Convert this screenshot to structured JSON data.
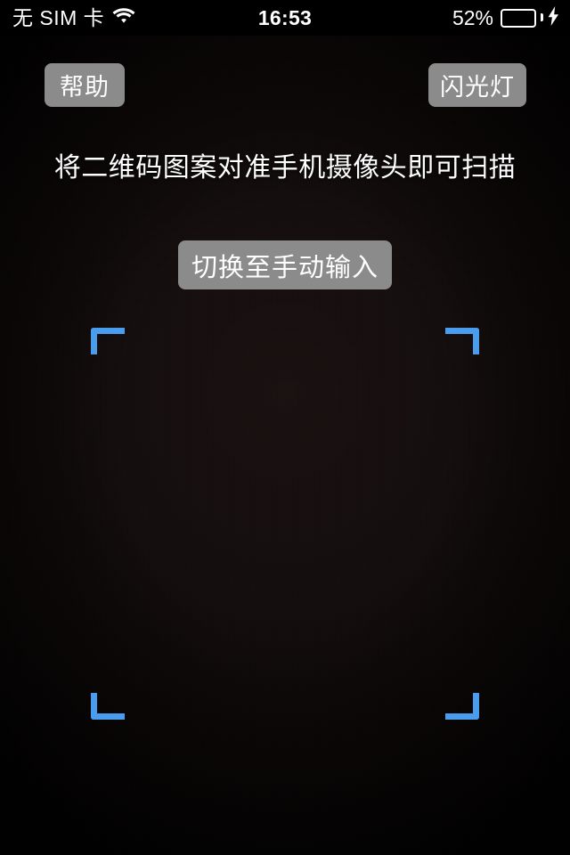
{
  "status_bar": {
    "carrier": "无 SIM 卡",
    "wifi_icon": "wifi-icon",
    "time": "16:53",
    "battery_percent_label": "52%",
    "battery_level": 52,
    "battery_fill_color": "#4cd964",
    "charging_icon": "lightning-bolt-icon",
    "background_color": "#000000",
    "text_color": "#ffffff"
  },
  "overlay": {
    "help_button_label": "帮助",
    "flash_button_label": "闪光灯",
    "hint_text": "将二维码图案对准手机摄像头即可扫描",
    "manual_input_button_label": "切换至手动输入",
    "button_background_color": "#8b8b8b",
    "button_text_color": "#ffffff"
  },
  "scanner": {
    "frame_corner_color": "#4a9ced",
    "viewfinder_background_color": "#0e0909"
  }
}
